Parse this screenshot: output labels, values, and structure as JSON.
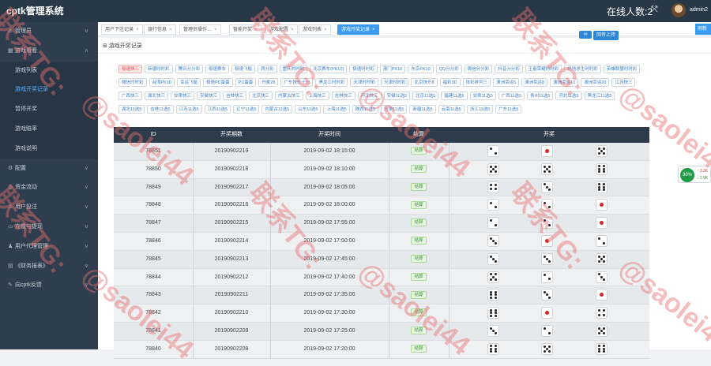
{
  "app": {
    "title": "cptk管理系统",
    "online_label": "在线人数:2",
    "user": "admin2"
  },
  "sidebar": {
    "items": [
      {
        "label": "管理员",
        "icon": "person-icon",
        "arrow": "∨",
        "type": "group"
      },
      {
        "label": "游戏看看",
        "icon": "grid-icon",
        "arrow": "∧",
        "type": "group"
      },
      {
        "label": "游戏列表",
        "type": "sub"
      },
      {
        "label": "游戏开奖记录",
        "type": "sub",
        "active": true
      },
      {
        "label": "暂停开奖",
        "type": "sub"
      },
      {
        "label": "游戏赔率",
        "type": "sub"
      },
      {
        "label": "游戏说明",
        "type": "sub"
      },
      {
        "label": "配置",
        "icon": "gear-icon",
        "arrow": "∨",
        "type": "group"
      },
      {
        "label": "资金流动",
        "icon": "coin-icon",
        "arrow": "∨",
        "type": "group"
      },
      {
        "label": "用户投注",
        "icon": "person-icon",
        "arrow": "∨",
        "type": "group"
      },
      {
        "label": "充值与提现",
        "icon": "card-icon",
        "arrow": "∨",
        "type": "group"
      },
      {
        "label": "用户代理管理",
        "icon": "people-icon",
        "arrow": "∨",
        "type": "group"
      },
      {
        "label": "《财务报表》",
        "icon": "chart-icon",
        "arrow": "∨",
        "type": "group"
      },
      {
        "label": "向cptk反馈",
        "icon": "feedback-icon",
        "arrow": "∨",
        "type": "group"
      }
    ]
  },
  "tabs": [
    {
      "label": "用户下注记录",
      "active": false
    },
    {
      "label": "银行信息",
      "active": false
    },
    {
      "label": "管理员操作…",
      "active": false
    },
    {
      "label": "暂能开奖",
      "active": false
    },
    {
      "label": "游戏配置",
      "active": false
    },
    {
      "label": "游戏列表",
      "active": false
    },
    {
      "label": "游戏开奖记录",
      "active": true
    }
  ],
  "panel": {
    "title": "游戏开奖记录",
    "upload_label": "回传上传",
    "right_button": "刷新"
  },
  "chips": [
    [
      "极速快三",
      "新疆时时彩",
      "腾讯分分彩",
      "极速赛车",
      "极速飞艇",
      "两分彩",
      "重庆时时彩",
      "北京赛车(PK10)",
      "极速时时彩",
      "澳门PK10",
      "东京PK10",
      "QQ分分彩",
      "微信分分彩",
      "抖音分分彩",
      "王者荣耀时时彩",
      "绝地求生时时彩",
      "英雄联盟时时彩"
    ],
    [
      "微信时时彩",
      "台湾PK10",
      "幸运飞艇",
      "极速PC蛋蛋",
      "PC蛋蛋",
      "丹麦28",
      "广东快乐十分",
      "黑龙江时时彩",
      "天津时时彩",
      "天津时时彩",
      "北京快乐8",
      "福彩3D",
      "体彩排列三",
      "澳洲幸运5",
      "澳洲幸运8",
      "澳洲幸运10",
      "澳洲幸运20",
      "江苏快三"
    ],
    [
      "广西快三",
      "湖北快三",
      "甘肃快三",
      "安徽快三",
      "吉林快三",
      "北京快三",
      "内蒙古快三",
      "上海快三",
      "吉林快三",
      "河北快三",
      "安徽11选5",
      "北京11选5",
      "福建11选5",
      "甘肃11选5",
      "广西11选5",
      "贵州11选5",
      "河北11选5",
      "黑龙江11选5"
    ],
    [
      "湖北11选5",
      "吉林11选5",
      "江苏11选5",
      "江西11选5",
      "辽宁11选5",
      "内蒙古11选5",
      "山东11选5",
      "上海11选5",
      "陕西11选5",
      "天津11选5",
      "新疆11选5",
      "云南11选5",
      "浙江11选5",
      "广东11选5"
    ]
  ],
  "table": {
    "headers": [
      "ID",
      "开奖期数",
      "开奖时间",
      "结算",
      "开奖"
    ],
    "rows": [
      {
        "id": "78851",
        "issue": "20190902219",
        "time": "2019-09-02 18:15:00",
        "status": "结算",
        "dice": [
          2,
          1,
          5
        ]
      },
      {
        "id": "78850",
        "issue": "20190902218",
        "time": "2019-09-02 18:10:00",
        "status": "结算",
        "dice": [
          5,
          5,
          6
        ]
      },
      {
        "id": "78849",
        "issue": "20190902217",
        "time": "2019-09-02 18:05:00",
        "status": "结算",
        "dice": [
          4,
          3,
          6
        ]
      },
      {
        "id": "78848",
        "issue": "20190902216",
        "time": "2019-09-02 18:00:00",
        "status": "结算",
        "dice": [
          2,
          2,
          1
        ]
      },
      {
        "id": "78847",
        "issue": "20190902215",
        "time": "2019-09-02 17:55:00",
        "status": "结算",
        "dice": [
          2,
          2,
          1
        ]
      },
      {
        "id": "78846",
        "issue": "20190902214",
        "time": "2019-09-02 17:50:00",
        "status": "结算",
        "dice": [
          3,
          1,
          2
        ]
      },
      {
        "id": "78845",
        "issue": "20190902213",
        "time": "2019-09-02 17:45:00",
        "status": "结算",
        "dice": [
          3,
          3,
          5
        ]
      },
      {
        "id": "78844",
        "issue": "20190902212",
        "time": "2019-09-02 17:40:00",
        "status": "结算",
        "dice": [
          5,
          2,
          3
        ]
      },
      {
        "id": "78843",
        "issue": "20190902211",
        "time": "2019-09-02 17:35:00",
        "status": "结算",
        "dice": [
          6,
          3,
          1
        ]
      },
      {
        "id": "78842",
        "issue": "20190902210",
        "time": "2019-09-02 17:30:00",
        "status": "结算",
        "dice": [
          6,
          1,
          4
        ]
      },
      {
        "id": "78841",
        "issue": "20190902209",
        "time": "2019-09-02 17:25:00",
        "status": "结算",
        "dice": [
          3,
          2,
          5
        ]
      },
      {
        "id": "78840",
        "issue": "20190902208",
        "time": "2019-09-02 17:20:00",
        "status": "结算",
        "dice": [
          6,
          5,
          6
        ]
      }
    ]
  },
  "float_widget": {
    "percent": "30%",
    "up": "3.3K",
    "down": "2.9K"
  },
  "watermark": {
    "contact": "联系TG:",
    "handle": "@saolei44"
  },
  "colors": {
    "topbar": "#283846",
    "sidebar": "#2f3e4e",
    "accent": "#3a9bf0",
    "active_chip": "#e0484f",
    "watermark": "#e66e6e",
    "table_head": "#2d3b4a"
  }
}
